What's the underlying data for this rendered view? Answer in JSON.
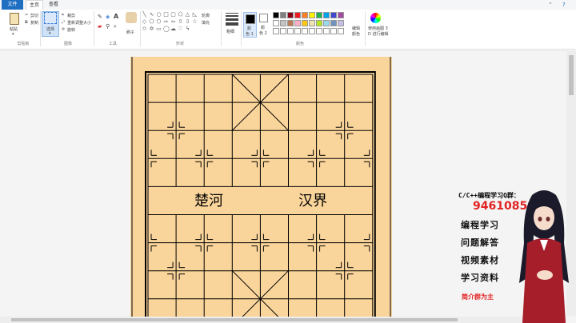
{
  "tabs": {
    "file": "文件",
    "home": "主页",
    "view": "查看"
  },
  "clipboard": {
    "paste": "粘贴",
    "cut": "剪切",
    "copy": "复制",
    "group": "剪贴板"
  },
  "image": {
    "select": "选择",
    "crop": "裁剪",
    "resize": "重新调整大小",
    "rotate": "旋转",
    "group": "图像"
  },
  "tools": {
    "group": "工具",
    "brushes": "刷子"
  },
  "shapes": {
    "outline": "轮廓",
    "fill": "填充",
    "group": "形状"
  },
  "size": {
    "label": "粗细"
  },
  "colors": {
    "color1_line1": "颜",
    "color1_line2": "色 1",
    "color2_line1": "颜",
    "color2_line2": "色 2",
    "group": "颜色",
    "edit_line1": "编辑",
    "edit_line2": "颜色",
    "paint3d_line1": "使用画图 3",
    "paint3d_line2": "D 进行编辑",
    "palette_row1": [
      "#000000",
      "#7f7f7f",
      "#880015",
      "#ed1c24",
      "#ff7f27",
      "#fff200",
      "#22b14c",
      "#00a2e8",
      "#3f48cc",
      "#a349a4"
    ],
    "palette_row2": [
      "#ffffff",
      "#c3c3c3",
      "#b97a57",
      "#ffaec9",
      "#ffc90e",
      "#efe4b0",
      "#b5e61d",
      "#99d9ea",
      "#7092be",
      "#c8bfe7"
    ],
    "palette_row3": [
      "#ffffff",
      "#ffffff",
      "#ffffff",
      "#ffffff",
      "#ffffff",
      "#ffffff",
      "#ffffff",
      "#ffffff",
      "#ffffff",
      "#ffffff"
    ]
  },
  "board": {
    "river_left": "楚河",
    "river_right": "汉界",
    "background": "#fad59b"
  },
  "promo": {
    "title": "C/C++编程学习Q群：",
    "qq": "946108597",
    "line1": "编程学习",
    "line2": "问题解答",
    "line3": "视频素材",
    "line4": "学习资料",
    "bottom": "简介群为主"
  }
}
